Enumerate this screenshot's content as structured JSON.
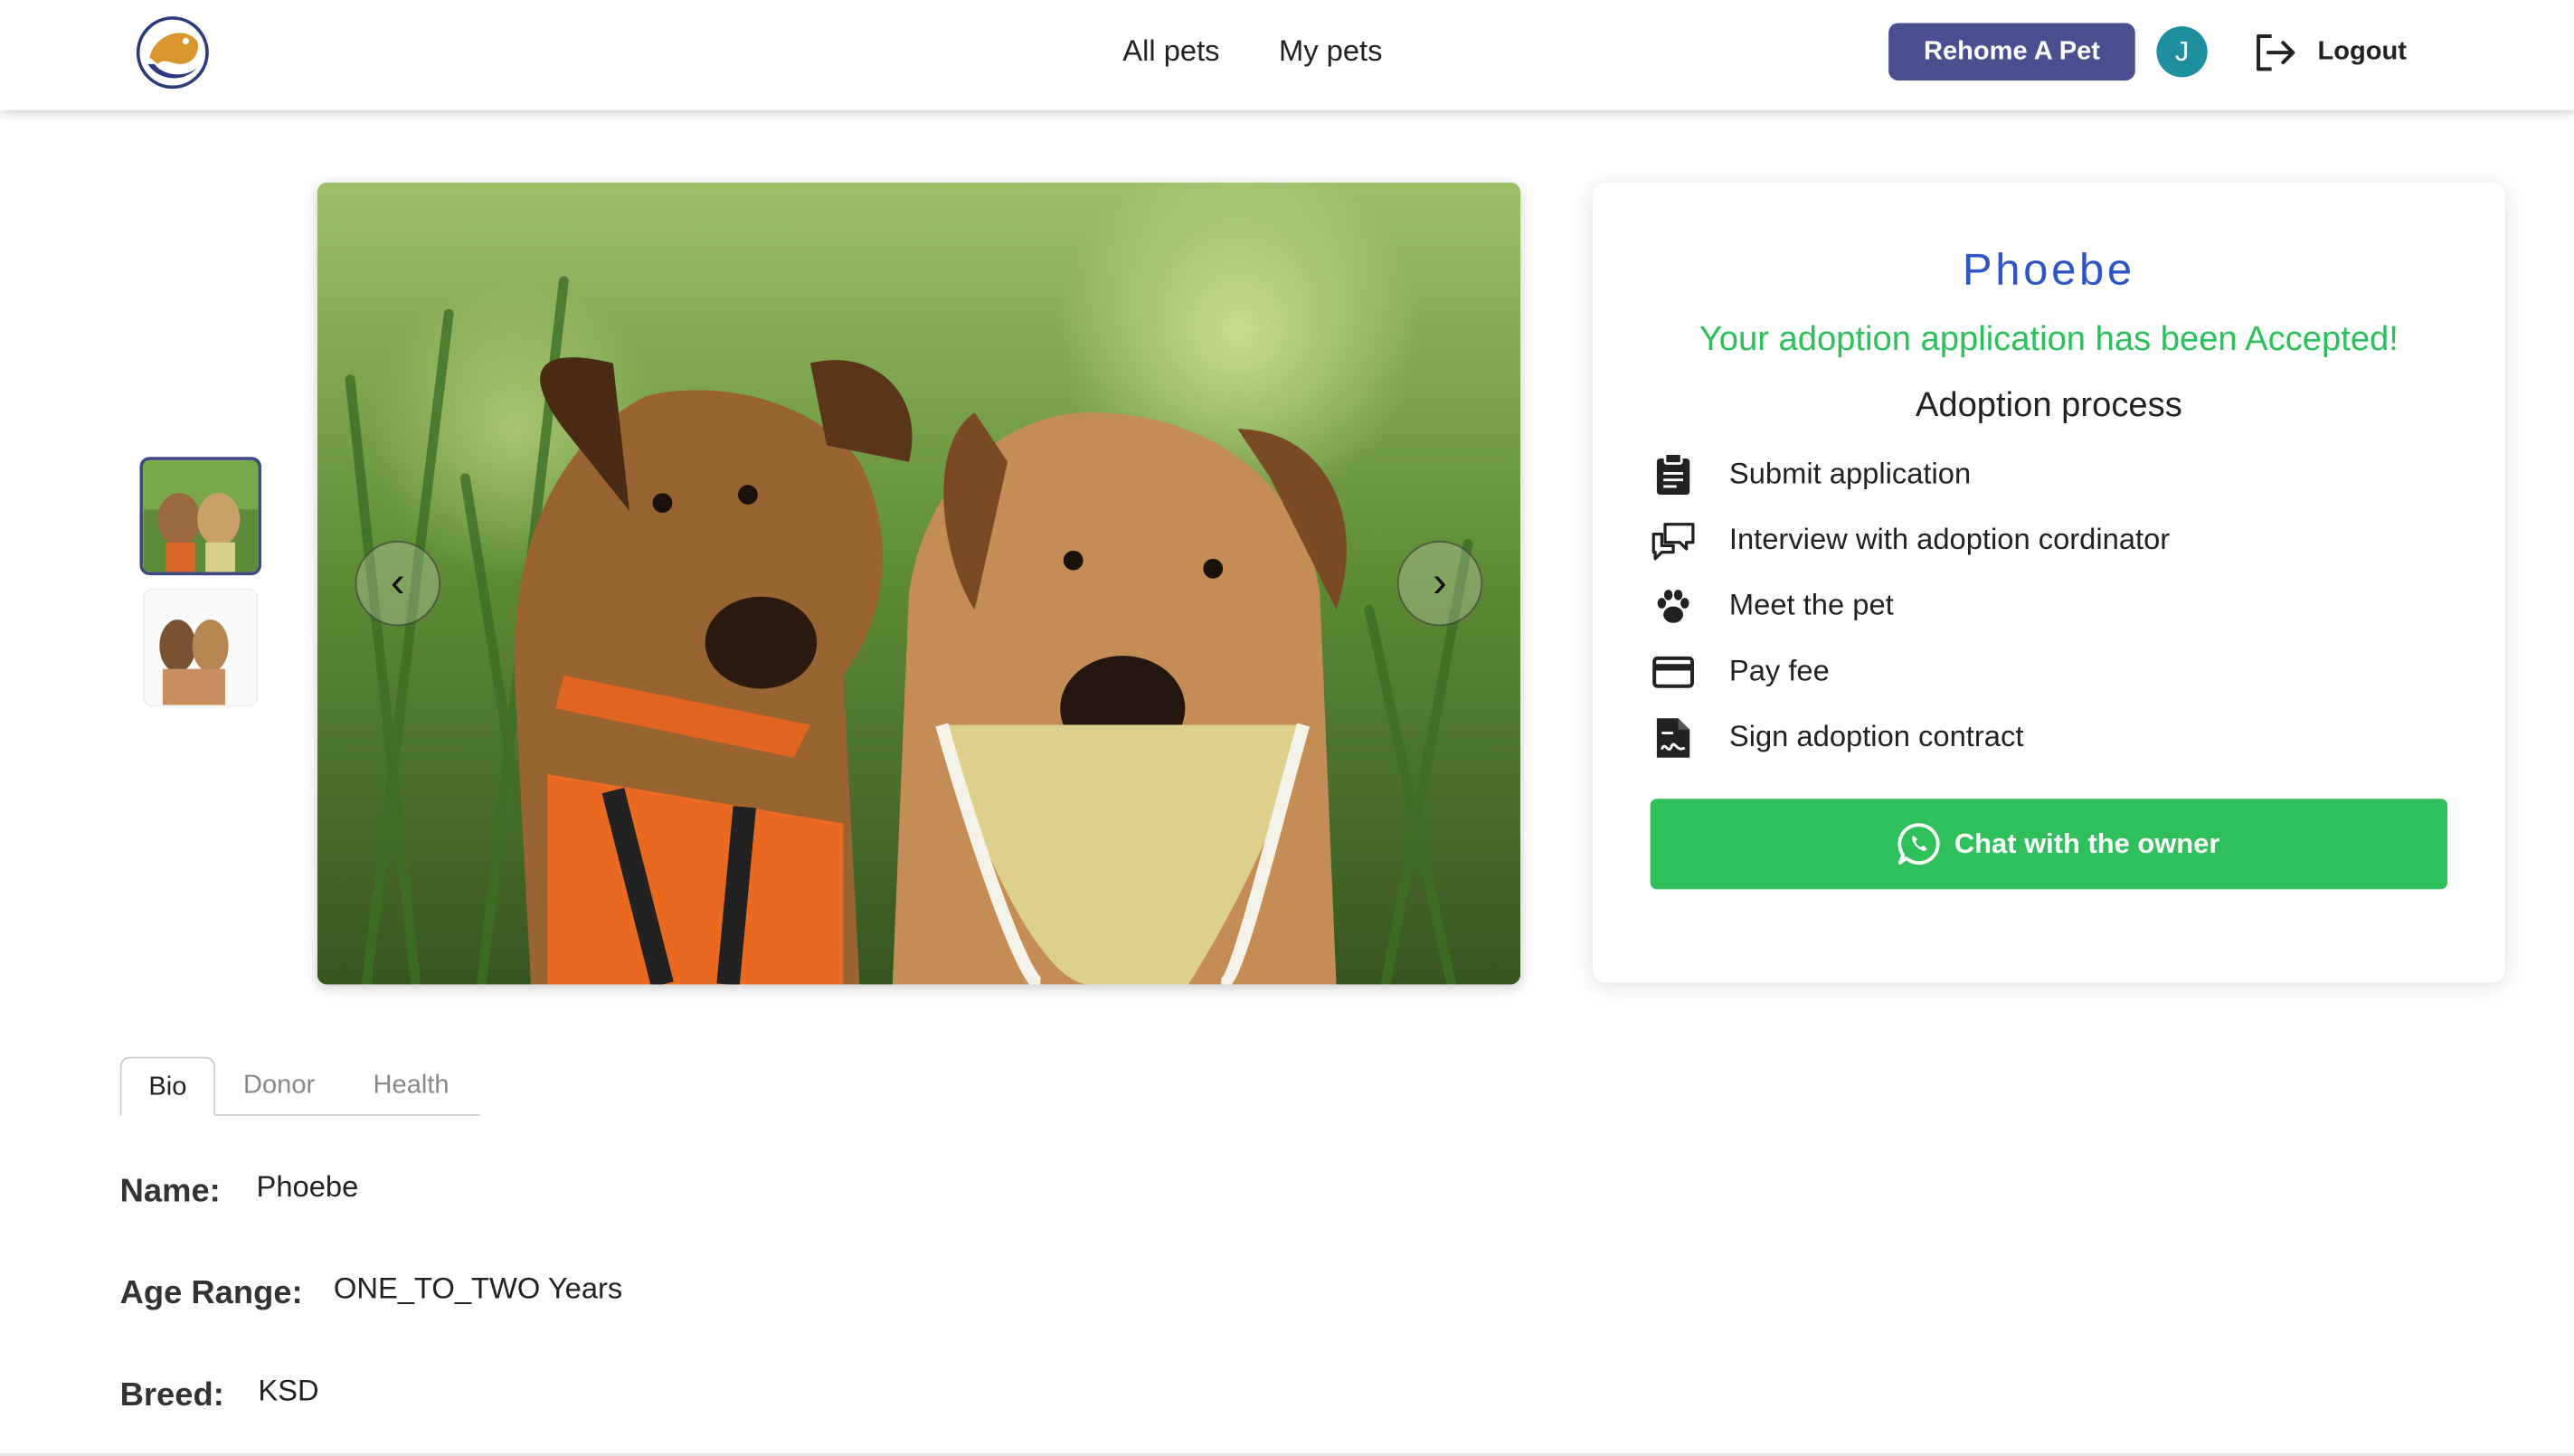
{
  "nav": {
    "links": [
      "All pets",
      "My pets"
    ],
    "rehome_label": "Rehome A Pet",
    "avatar_initial": "J",
    "logout_label": "Logout"
  },
  "gallery": {
    "prev_symbol": "‹",
    "next_symbol": "›"
  },
  "card": {
    "pet_name": "Phoebe",
    "status": "Your adoption application has been Accepted!",
    "process_title": "Adoption process",
    "steps": [
      {
        "label": "Submit application",
        "icon": "clipboard-icon"
      },
      {
        "label": "Interview with adoption cordinator",
        "icon": "chat-bubbles-icon"
      },
      {
        "label": "Meet the pet",
        "icon": "paw-icon"
      },
      {
        "label": "Pay fee",
        "icon": "credit-card-icon"
      },
      {
        "label": "Sign adoption contract",
        "icon": "contract-icon"
      }
    ],
    "chat_label": "Chat with the owner",
    "accent_color": "#2fbf5b",
    "name_color": "#2f55c4"
  },
  "tabs": [
    "Bio",
    "Donor",
    "Health"
  ],
  "bio": [
    {
      "label": "Name:",
      "value": "Phoebe"
    },
    {
      "label": "Age Range:",
      "value": "ONE_TO_TWO Years"
    },
    {
      "label": "Breed:",
      "value": "KSD"
    }
  ]
}
